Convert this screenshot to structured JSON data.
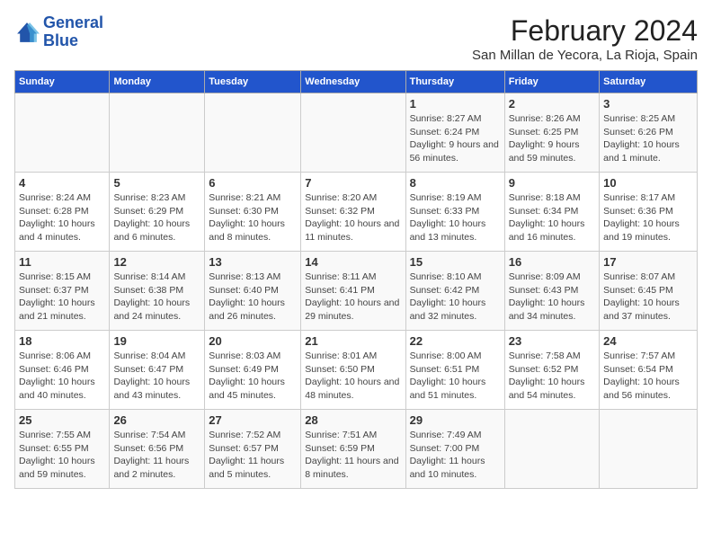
{
  "logo": {
    "line1": "General",
    "line2": "Blue"
  },
  "title": "February 2024",
  "subtitle": "San Millan de Yecora, La Rioja, Spain",
  "days_header": [
    "Sunday",
    "Monday",
    "Tuesday",
    "Wednesday",
    "Thursday",
    "Friday",
    "Saturday"
  ],
  "weeks": [
    [
      {
        "day": "",
        "info": ""
      },
      {
        "day": "",
        "info": ""
      },
      {
        "day": "",
        "info": ""
      },
      {
        "day": "",
        "info": ""
      },
      {
        "day": "1",
        "info": "Sunrise: 8:27 AM\nSunset: 6:24 PM\nDaylight: 9 hours and 56 minutes."
      },
      {
        "day": "2",
        "info": "Sunrise: 8:26 AM\nSunset: 6:25 PM\nDaylight: 9 hours and 59 minutes."
      },
      {
        "day": "3",
        "info": "Sunrise: 8:25 AM\nSunset: 6:26 PM\nDaylight: 10 hours and 1 minute."
      }
    ],
    [
      {
        "day": "4",
        "info": "Sunrise: 8:24 AM\nSunset: 6:28 PM\nDaylight: 10 hours and 4 minutes."
      },
      {
        "day": "5",
        "info": "Sunrise: 8:23 AM\nSunset: 6:29 PM\nDaylight: 10 hours and 6 minutes."
      },
      {
        "day": "6",
        "info": "Sunrise: 8:21 AM\nSunset: 6:30 PM\nDaylight: 10 hours and 8 minutes."
      },
      {
        "day": "7",
        "info": "Sunrise: 8:20 AM\nSunset: 6:32 PM\nDaylight: 10 hours and 11 minutes."
      },
      {
        "day": "8",
        "info": "Sunrise: 8:19 AM\nSunset: 6:33 PM\nDaylight: 10 hours and 13 minutes."
      },
      {
        "day": "9",
        "info": "Sunrise: 8:18 AM\nSunset: 6:34 PM\nDaylight: 10 hours and 16 minutes."
      },
      {
        "day": "10",
        "info": "Sunrise: 8:17 AM\nSunset: 6:36 PM\nDaylight: 10 hours and 19 minutes."
      }
    ],
    [
      {
        "day": "11",
        "info": "Sunrise: 8:15 AM\nSunset: 6:37 PM\nDaylight: 10 hours and 21 minutes."
      },
      {
        "day": "12",
        "info": "Sunrise: 8:14 AM\nSunset: 6:38 PM\nDaylight: 10 hours and 24 minutes."
      },
      {
        "day": "13",
        "info": "Sunrise: 8:13 AM\nSunset: 6:40 PM\nDaylight: 10 hours and 26 minutes."
      },
      {
        "day": "14",
        "info": "Sunrise: 8:11 AM\nSunset: 6:41 PM\nDaylight: 10 hours and 29 minutes."
      },
      {
        "day": "15",
        "info": "Sunrise: 8:10 AM\nSunset: 6:42 PM\nDaylight: 10 hours and 32 minutes."
      },
      {
        "day": "16",
        "info": "Sunrise: 8:09 AM\nSunset: 6:43 PM\nDaylight: 10 hours and 34 minutes."
      },
      {
        "day": "17",
        "info": "Sunrise: 8:07 AM\nSunset: 6:45 PM\nDaylight: 10 hours and 37 minutes."
      }
    ],
    [
      {
        "day": "18",
        "info": "Sunrise: 8:06 AM\nSunset: 6:46 PM\nDaylight: 10 hours and 40 minutes."
      },
      {
        "day": "19",
        "info": "Sunrise: 8:04 AM\nSunset: 6:47 PM\nDaylight: 10 hours and 43 minutes."
      },
      {
        "day": "20",
        "info": "Sunrise: 8:03 AM\nSunset: 6:49 PM\nDaylight: 10 hours and 45 minutes."
      },
      {
        "day": "21",
        "info": "Sunrise: 8:01 AM\nSunset: 6:50 PM\nDaylight: 10 hours and 48 minutes."
      },
      {
        "day": "22",
        "info": "Sunrise: 8:00 AM\nSunset: 6:51 PM\nDaylight: 10 hours and 51 minutes."
      },
      {
        "day": "23",
        "info": "Sunrise: 7:58 AM\nSunset: 6:52 PM\nDaylight: 10 hours and 54 minutes."
      },
      {
        "day": "24",
        "info": "Sunrise: 7:57 AM\nSunset: 6:54 PM\nDaylight: 10 hours and 56 minutes."
      }
    ],
    [
      {
        "day": "25",
        "info": "Sunrise: 7:55 AM\nSunset: 6:55 PM\nDaylight: 10 hours and 59 minutes."
      },
      {
        "day": "26",
        "info": "Sunrise: 7:54 AM\nSunset: 6:56 PM\nDaylight: 11 hours and 2 minutes."
      },
      {
        "day": "27",
        "info": "Sunrise: 7:52 AM\nSunset: 6:57 PM\nDaylight: 11 hours and 5 minutes."
      },
      {
        "day": "28",
        "info": "Sunrise: 7:51 AM\nSunset: 6:59 PM\nDaylight: 11 hours and 8 minutes."
      },
      {
        "day": "29",
        "info": "Sunrise: 7:49 AM\nSunset: 7:00 PM\nDaylight: 11 hours and 10 minutes."
      },
      {
        "day": "",
        "info": ""
      },
      {
        "day": "",
        "info": ""
      }
    ]
  ]
}
